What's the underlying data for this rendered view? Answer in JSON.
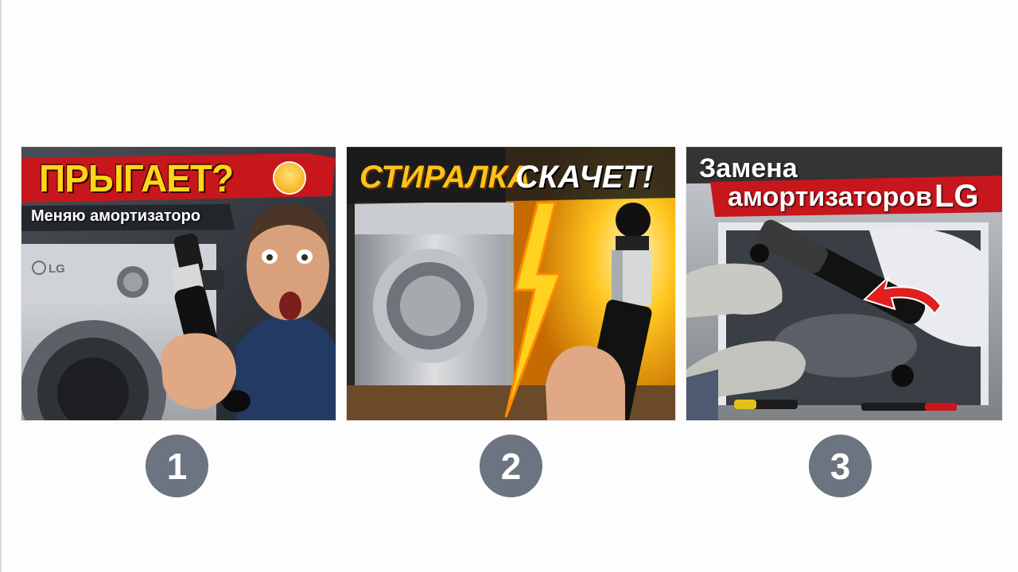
{
  "thumbnails": [
    {
      "number": "1",
      "title": "ПРЫГАЕТ?",
      "subtitle": "Меняю амортизаторо",
      "brand": "LG"
    },
    {
      "number": "2",
      "title_part1": "СТИРАЛКА",
      "title_part2": "СКАЧЕТ!"
    },
    {
      "number": "3",
      "line1": "Замена",
      "line2": "амортизаторов",
      "brand": "LG"
    }
  ],
  "colors": {
    "banner_red": "#c8161d",
    "title_yellow": "#ffd51a",
    "badge_gray": "#6b7480"
  },
  "icons": {
    "thumb1_emoji": "scared-face-icon",
    "thumb2_symbol": "lightning-bolt-icon",
    "thumb3_arrow": "red-curved-arrow-icon"
  }
}
